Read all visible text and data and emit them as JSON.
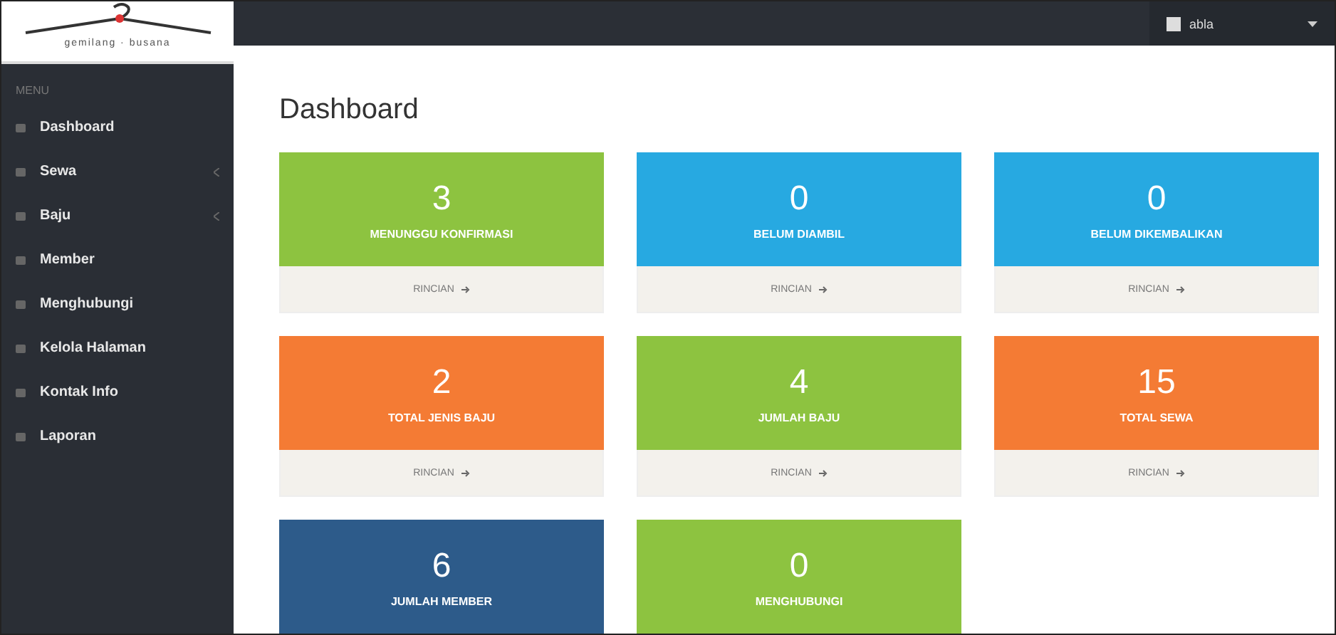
{
  "sidebar": {
    "logo_caption": "gemilang · busana",
    "heading": "MENU",
    "items": [
      {
        "label": "Dashboard",
        "expandable": false
      },
      {
        "label": "Sewa",
        "expandable": true
      },
      {
        "label": "Baju",
        "expandable": true
      },
      {
        "label": "Member",
        "expandable": false
      },
      {
        "label": "Menghubungi",
        "expandable": false
      },
      {
        "label": "Kelola Halaman",
        "expandable": false
      },
      {
        "label": "Kontak Info",
        "expandable": false
      },
      {
        "label": "Laporan",
        "expandable": false
      }
    ]
  },
  "topbar": {
    "user": "abla"
  },
  "page_title": "Dashboard",
  "cards": [
    {
      "value": "3",
      "label": "MENUNGGU KONFIRMASI",
      "link": "RINCIAN",
      "color": "#8dc340"
    },
    {
      "value": "0",
      "label": "BELUM DIAMBIL",
      "link": "RINCIAN",
      "color": "#27a9e1"
    },
    {
      "value": "0",
      "label": "BELUM DIKEMBALIKAN",
      "link": "RINCIAN",
      "color": "#27a9e1"
    },
    {
      "value": "2",
      "label": "TOTAL JENIS BAJU",
      "link": "RINCIAN",
      "color": "#f47b34"
    },
    {
      "value": "4",
      "label": "JUMLAH BAJU",
      "link": "RINCIAN",
      "color": "#8dc340"
    },
    {
      "value": "15",
      "label": "TOTAL SEWA",
      "link": "RINCIAN",
      "color": "#f47b34"
    },
    {
      "value": "6",
      "label": "JUMLAH MEMBER",
      "color": "#2d5b8a"
    },
    {
      "value": "0",
      "label": "MENGHUBUNGI",
      "color": "#8dc340"
    }
  ]
}
